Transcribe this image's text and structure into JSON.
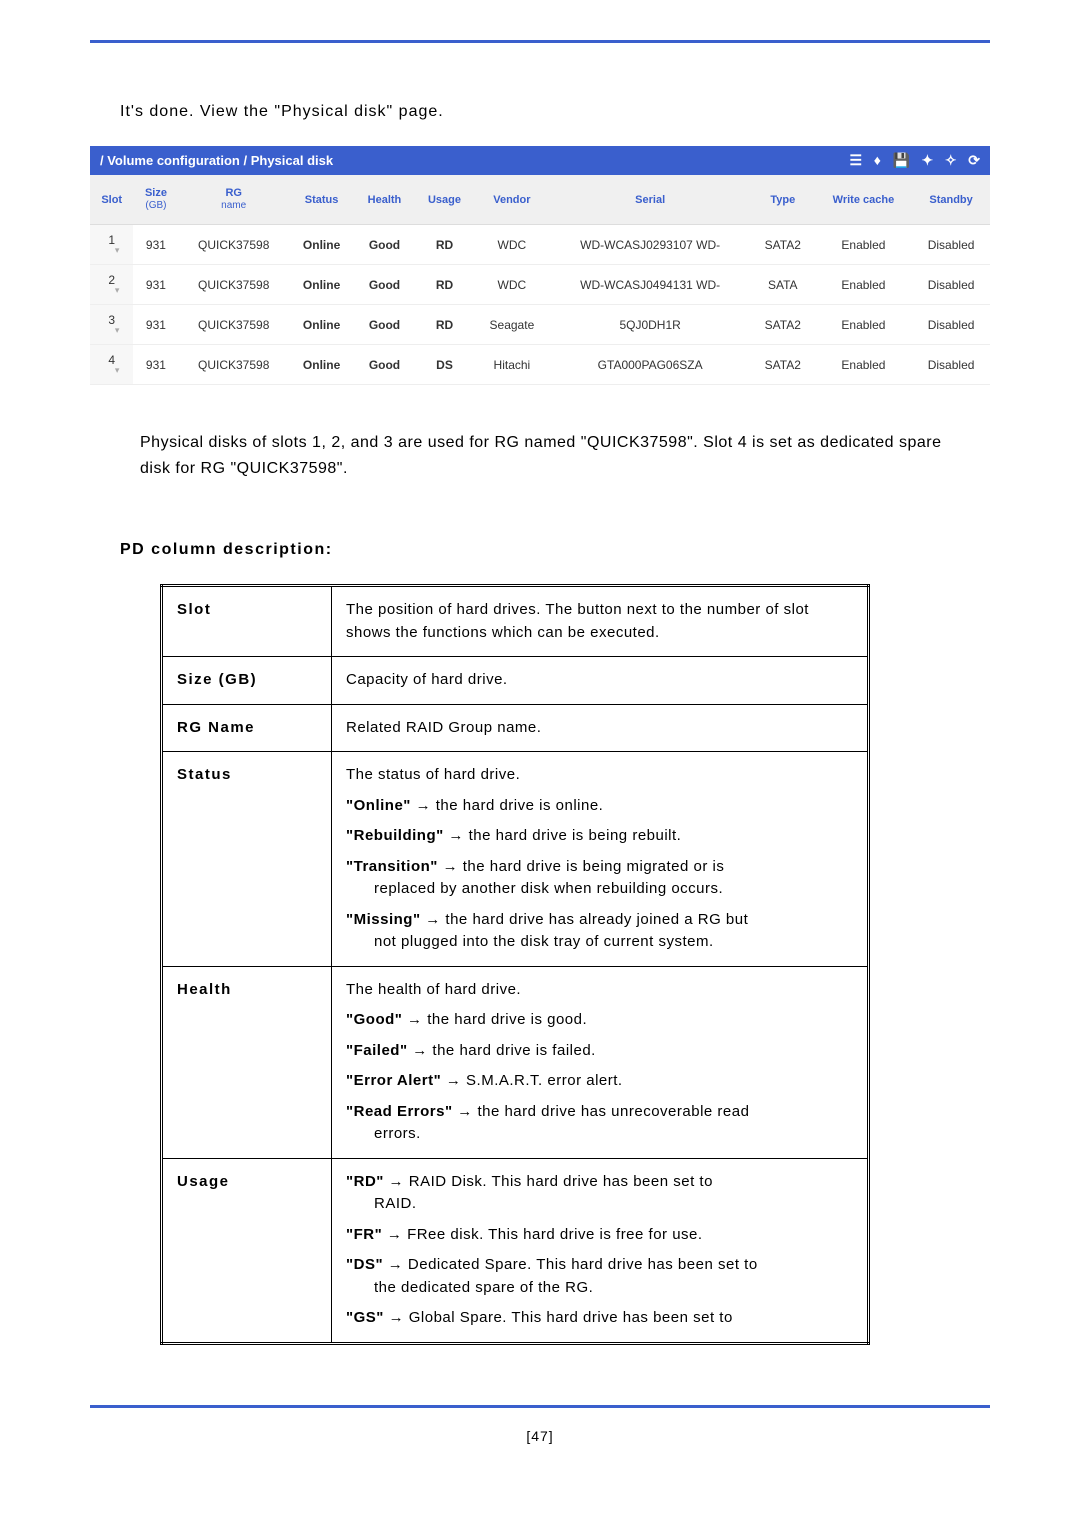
{
  "lead_text": "It's done. View the \"Physical disk\" page.",
  "breadcrumb": "/ Volume configuration / Physical disk",
  "pd_headers": {
    "slot": "Slot",
    "size": "Size",
    "size_sub": "(GB)",
    "rg": "RG",
    "rg_sub": "name",
    "status": "Status",
    "health": "Health",
    "usage": "Usage",
    "vendor": "Vendor",
    "serial": "Serial",
    "type": "Type",
    "wcache": "Write cache",
    "standby": "Standby"
  },
  "pd_rows": [
    {
      "slot": "1",
      "size": "931",
      "rg": "QUICK37598",
      "status": "Online",
      "health": "Good",
      "usage": "RD",
      "vendor": "WDC",
      "serial": "WD-WCASJ0293107 WD-",
      "type": "SATA2",
      "wcache": "Enabled",
      "standby": "Disabled"
    },
    {
      "slot": "2",
      "size": "931",
      "rg": "QUICK37598",
      "status": "Online",
      "health": "Good",
      "usage": "RD",
      "vendor": "WDC",
      "serial": "WD-WCASJ0494131 WD-",
      "type": "SATA",
      "wcache": "Enabled",
      "standby": "Disabled"
    },
    {
      "slot": "3",
      "size": "931",
      "rg": "QUICK37598",
      "status": "Online",
      "health": "Good",
      "usage": "RD",
      "vendor": "Seagate",
      "serial": "5QJ0DH1R",
      "type": "SATA2",
      "wcache": "Enabled",
      "standby": "Disabled"
    },
    {
      "slot": "4",
      "size": "931",
      "rg": "QUICK37598",
      "status": "Online",
      "health": "Good",
      "usage": "DS",
      "vendor": "Hitachi",
      "serial": "GTA000PAG06SZA",
      "type": "SATA2",
      "wcache": "Enabled",
      "standby": "Disabled"
    }
  ],
  "note_text": "Physical disks of slots 1, 2, and 3 are used for RG named \"QUICK37598\". Slot 4 is set as dedicated spare disk for RG \"QUICK37598\".",
  "desc_heading": "PD column description:",
  "desc": {
    "slot_label": "Slot",
    "slot_text": "The position of hard drives. The button next to the number of slot shows the functions which can be executed.",
    "size_label": "Size (GB)",
    "size_text": "Capacity of hard drive.",
    "rg_label": "RG Name",
    "rg_text": "Related RAID Group name.",
    "status_label": "Status",
    "status_intro": "The status of hard drive.",
    "status_online_term": "\"Online\"",
    "status_online_tail": " the hard drive is online.",
    "status_rebuilding_term": "\"Rebuilding\"",
    "status_rebuilding_tail": " the hard drive is being rebuilt.",
    "status_transition_term": "\"Transition\"",
    "status_transition_tail": " the hard drive is being migrated or is",
    "status_transition_indent": "replaced by another disk when rebuilding occurs.",
    "status_missing_term": "\"Missing\"",
    "status_missing_tail": " the hard drive has already joined a RG but",
    "status_missing_indent": "not plugged into the disk tray of current system.",
    "health_label": "Health",
    "health_intro": "The health of hard drive.",
    "health_good_term": "\"Good\"",
    "health_good_tail": " the hard drive is good.",
    "health_failed_term": "\"Failed\"",
    "health_failed_tail": " the hard drive is failed.",
    "health_error_term": "\"Error Alert\"",
    "health_error_tail": " S.M.A.R.T. error alert.",
    "health_read_term": "\"Read Errors\"",
    "health_read_tail": " the hard drive has unrecoverable read",
    "health_read_indent": "errors.",
    "usage_label": "Usage",
    "usage_rd_term": "\"RD\"",
    "usage_rd_tail": " RAID Disk. This hard drive has been set to",
    "usage_rd_indent": "RAID.",
    "usage_fr_term": "\"FR\"",
    "usage_fr_tail": " FRee disk. This hard drive is free for use.",
    "usage_ds_term": "\"DS\"",
    "usage_ds_tail": " Dedicated Spare. This hard drive has been set to",
    "usage_ds_indent": "the dedicated spare of the RG.",
    "usage_gs_term": "\"GS\"",
    "usage_gs_tail": " Global Spare. This hard drive has been set to"
  },
  "arrow": " → ",
  "page_number": "[47]"
}
